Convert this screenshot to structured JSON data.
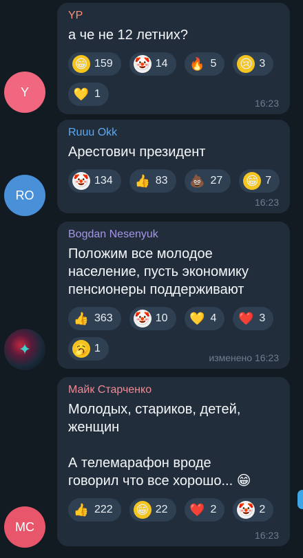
{
  "messages": [
    {
      "sender": "YP",
      "sender_color": "#ff8e78",
      "avatar_text": "Y",
      "avatar_color": "#f0677f",
      "lines": [
        "а че не 12 летних?"
      ],
      "reactions": [
        {
          "icon": "grinning-face-icon",
          "glyph": "😁",
          "count": "159"
        },
        {
          "icon": "clown-face-icon",
          "glyph": "🤡",
          "count": "14"
        },
        {
          "icon": "fire-icon",
          "glyph": "🔥",
          "count": "5"
        },
        {
          "icon": "crying-face-icon",
          "glyph": "😢",
          "count": "3"
        },
        {
          "icon": "gold-heart-icon",
          "glyph": "💛",
          "count": "1"
        }
      ],
      "time": "16:23"
    },
    {
      "sender": "Ruuu Okk",
      "sender_color": "#5ea9f0",
      "avatar_text": "RO",
      "avatar_color": "#4a90d9",
      "lines": [
        "Арестович президент"
      ],
      "reactions": [
        {
          "icon": "clown-face-icon",
          "glyph": "🤡",
          "count": "134"
        },
        {
          "icon": "thumbs-up-icon",
          "glyph": "👍",
          "count": "83"
        },
        {
          "icon": "pile-of-poo-icon",
          "glyph": "💩",
          "count": "27"
        },
        {
          "icon": "grinning-face-icon",
          "glyph": "😁",
          "count": "7"
        }
      ],
      "time": "16:23"
    },
    {
      "sender": "Bogdan Nesenyuk",
      "sender_color": "#a695e7",
      "avatar_text": "",
      "avatar_color": "#1a1f2a",
      "lines": [
        "Положим все молодое",
        "население, пусть экономику",
        "пенсионеры поддерживают"
      ],
      "reactions": [
        {
          "icon": "thumbs-up-icon",
          "glyph": "👍",
          "count": "363"
        },
        {
          "icon": "clown-face-icon",
          "glyph": "🤡",
          "count": "10"
        },
        {
          "icon": "gold-heart-icon",
          "glyph": "💛",
          "count": "4"
        },
        {
          "icon": "red-heart-icon",
          "glyph": "❤️",
          "count": "3"
        },
        {
          "icon": "yawning-face-icon",
          "glyph": "🥱",
          "count": "1"
        }
      ],
      "time": "изменено 16:23"
    },
    {
      "sender": "Майк Старченко",
      "sender_color": "#f08a94",
      "avatar_text": "MC",
      "avatar_color": "#e8566b",
      "lines": [
        "Молодых, стариков, детей,",
        "женщин",
        "",
        "А телемарафон вроде",
        "говорил что все хорошо... 😁"
      ],
      "reactions": [
        {
          "icon": "thumbs-up-icon",
          "glyph": "👍",
          "count": "222"
        },
        {
          "icon": "grinning-face-icon",
          "glyph": "😁",
          "count": "22"
        },
        {
          "icon": "red-heart-icon",
          "glyph": "❤️",
          "count": "2"
        },
        {
          "icon": "clown-face-icon",
          "glyph": "🤡",
          "count": "2"
        }
      ],
      "time": "16:23"
    }
  ]
}
